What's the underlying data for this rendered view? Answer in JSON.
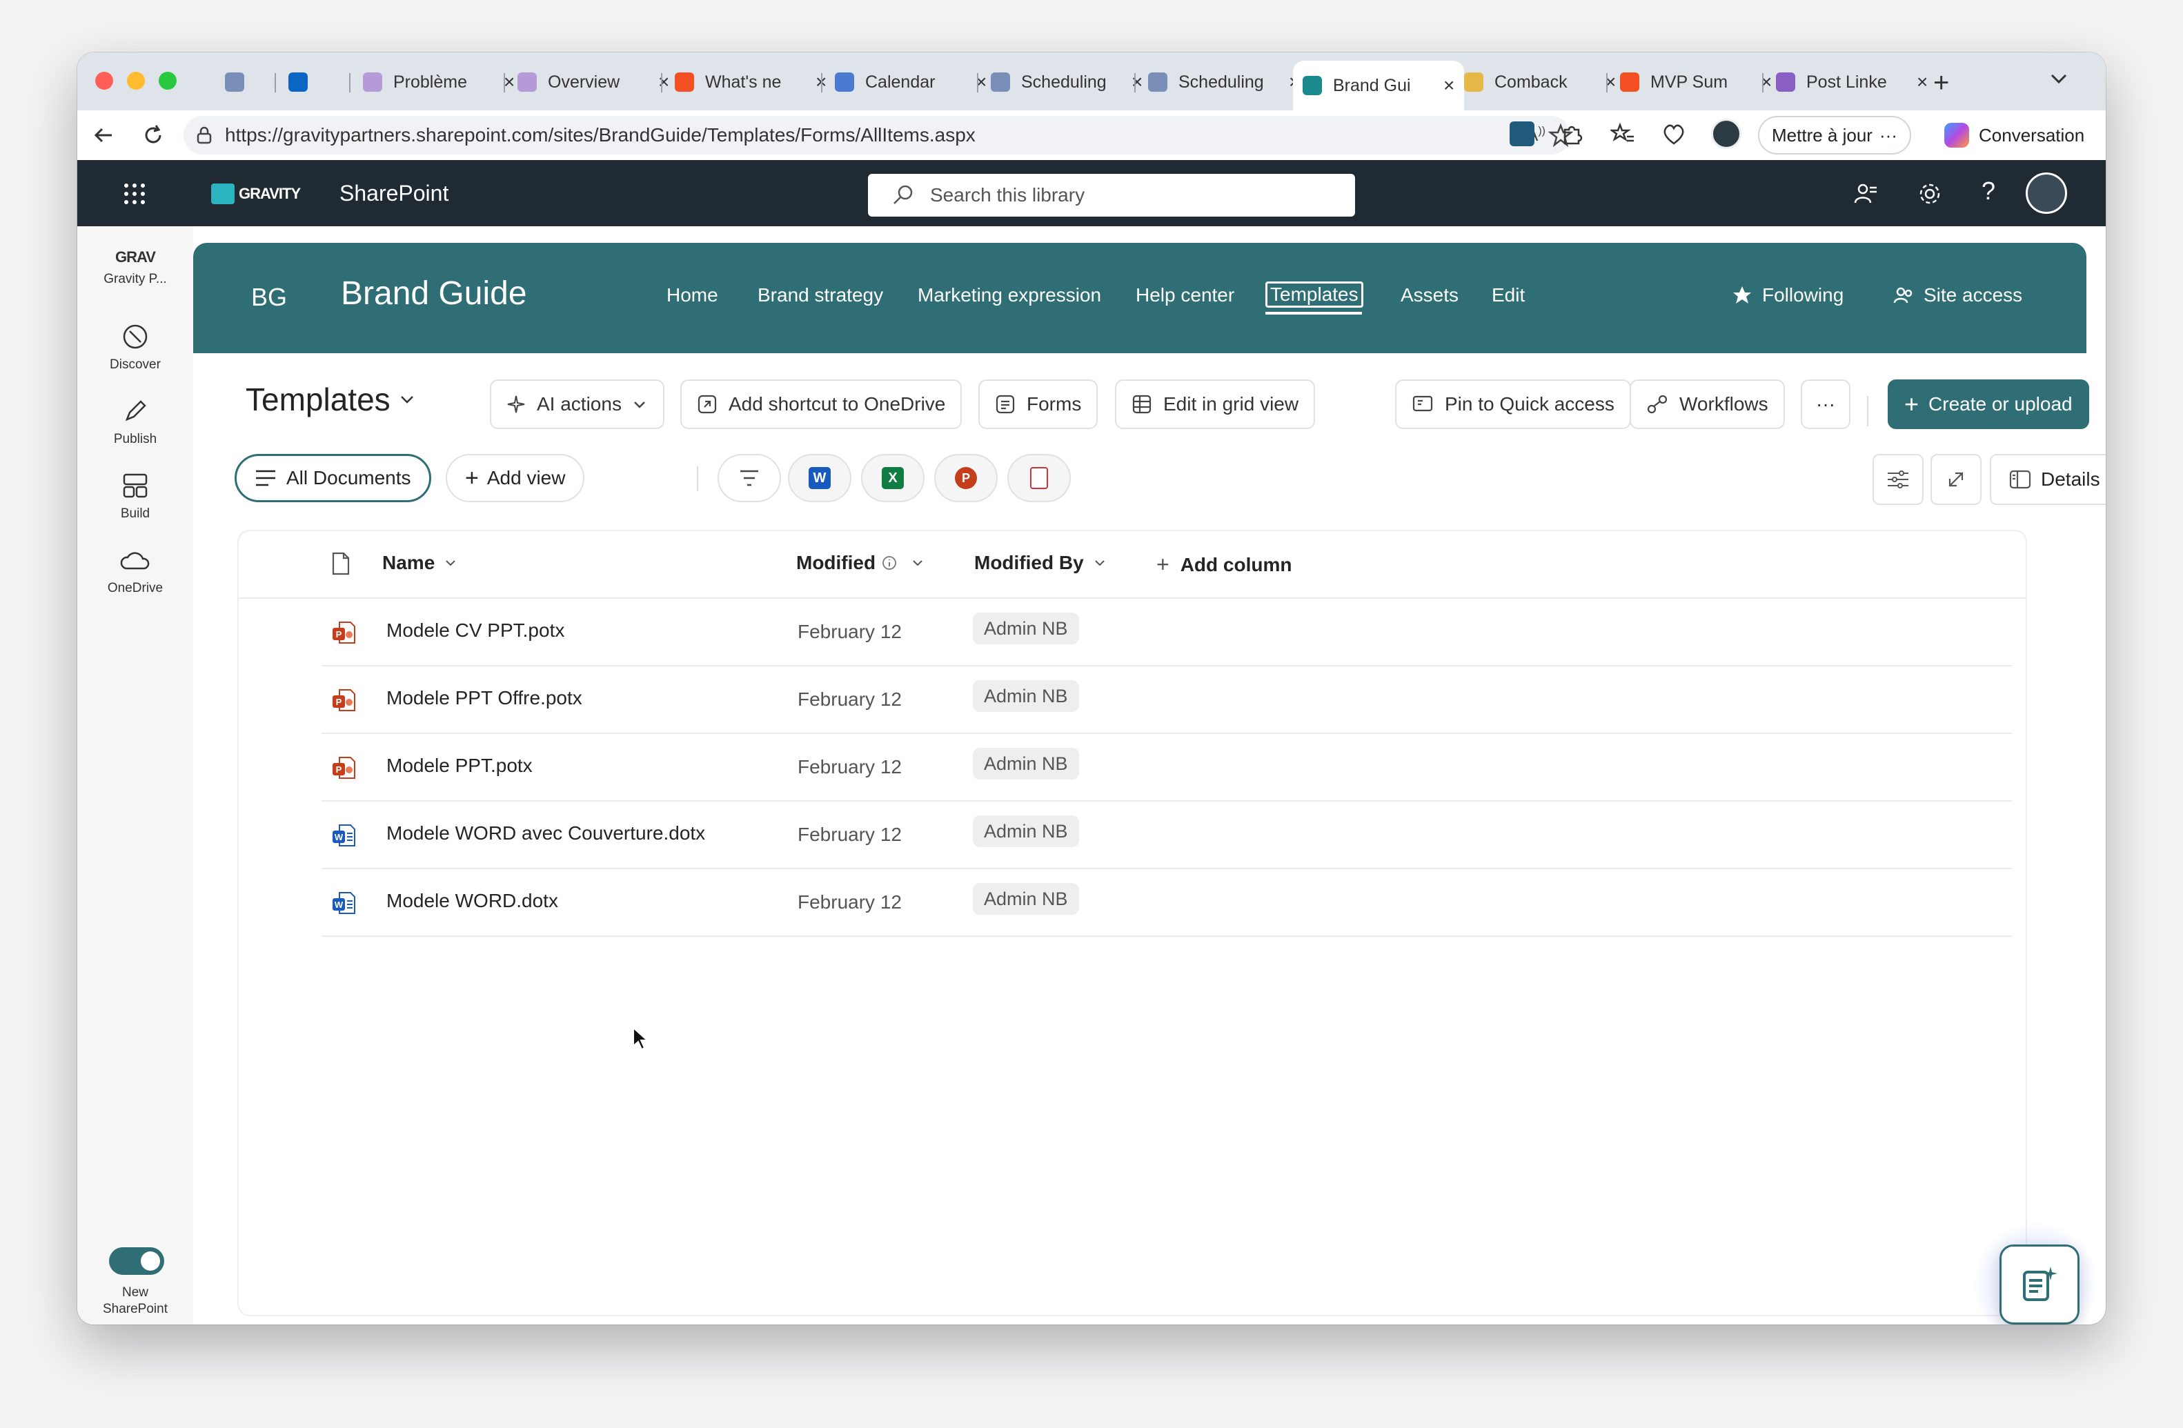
{
  "browser": {
    "tabs": [
      {
        "title": "",
        "color": "#7a8fb8"
      },
      {
        "title": "",
        "color": "#0a66c2"
      },
      {
        "title": "Problème",
        "color": "#b59ad8"
      },
      {
        "title": "Overview",
        "color": "#b59ad8"
      },
      {
        "title": "What's ne",
        "color": "#f25022"
      },
      {
        "title": "Calendar",
        "color": "#4a7bd0"
      },
      {
        "title": "Scheduling",
        "color": "#7a8fb8"
      },
      {
        "title": "Scheduling",
        "color": "#7a8fb8"
      },
      {
        "title": "Brand Gui",
        "color": "#1b8a8f"
      },
      {
        "title": "Comback",
        "color": "#e6b84a"
      },
      {
        "title": "MVP Sum",
        "color": "#f25022"
      },
      {
        "title": "Post Linke",
        "color": "#8a5fc4"
      }
    ],
    "url": "https://gravitypartners.sharepoint.com/sites/BrandGuide/Templates/Forms/AllItems.aspx",
    "update_label": "Mettre à jour",
    "copilot_label": "Conversation"
  },
  "suitebar": {
    "logo_text": "GRAVITY",
    "app_name": "SharePoint",
    "search_placeholder": "Search this library"
  },
  "rail": {
    "items": [
      {
        "label": "Gravity P...",
        "icon": "gravity-logo-icon"
      },
      {
        "label": "Discover",
        "icon": "compass-icon"
      },
      {
        "label": "Publish",
        "icon": "pen-icon"
      },
      {
        "label": "Build",
        "icon": "layout-icon"
      },
      {
        "label": "OneDrive",
        "icon": "cloud-icon"
      }
    ],
    "toggle_label_1": "New",
    "toggle_label_2": "SharePoint"
  },
  "site": {
    "initials": "BG",
    "title": "Brand Guide",
    "nav": [
      "Home",
      "Brand strategy",
      "Marketing expression",
      "Help center",
      "Templates",
      "Assets",
      "Edit"
    ],
    "following_label": "Following",
    "site_access_label": "Site access",
    "accent": "#2e6e74"
  },
  "library": {
    "title": "Templates",
    "commands": {
      "ai": "AI actions",
      "shortcut": "Add shortcut to OneDrive",
      "forms": "Forms",
      "grid": "Edit in grid view",
      "pin": "Pin to Quick access",
      "workflows": "Workflows",
      "more": "···",
      "create": "Create or upload"
    },
    "views": {
      "all": "All Documents",
      "add": "Add view"
    },
    "details_label": "Details",
    "columns": {
      "name": "Name",
      "modified": "Modified",
      "modified_by": "Modified By",
      "add_column": "Add column"
    },
    "rows": [
      {
        "name": "Modele CV PPT.potx",
        "type": "ppt",
        "modified": "February 12",
        "by": "Admin NB"
      },
      {
        "name": "Modele PPT Offre.potx",
        "type": "ppt",
        "modified": "February 12",
        "by": "Admin NB"
      },
      {
        "name": "Modele PPT.potx",
        "type": "ppt",
        "modified": "February 12",
        "by": "Admin NB"
      },
      {
        "name": "Modele WORD avec Couverture.dotx",
        "type": "word",
        "modified": "February 12",
        "by": "Admin NB"
      },
      {
        "name": "Modele WORD.dotx",
        "type": "word",
        "modified": "February 12",
        "by": "Admin NB"
      }
    ]
  }
}
